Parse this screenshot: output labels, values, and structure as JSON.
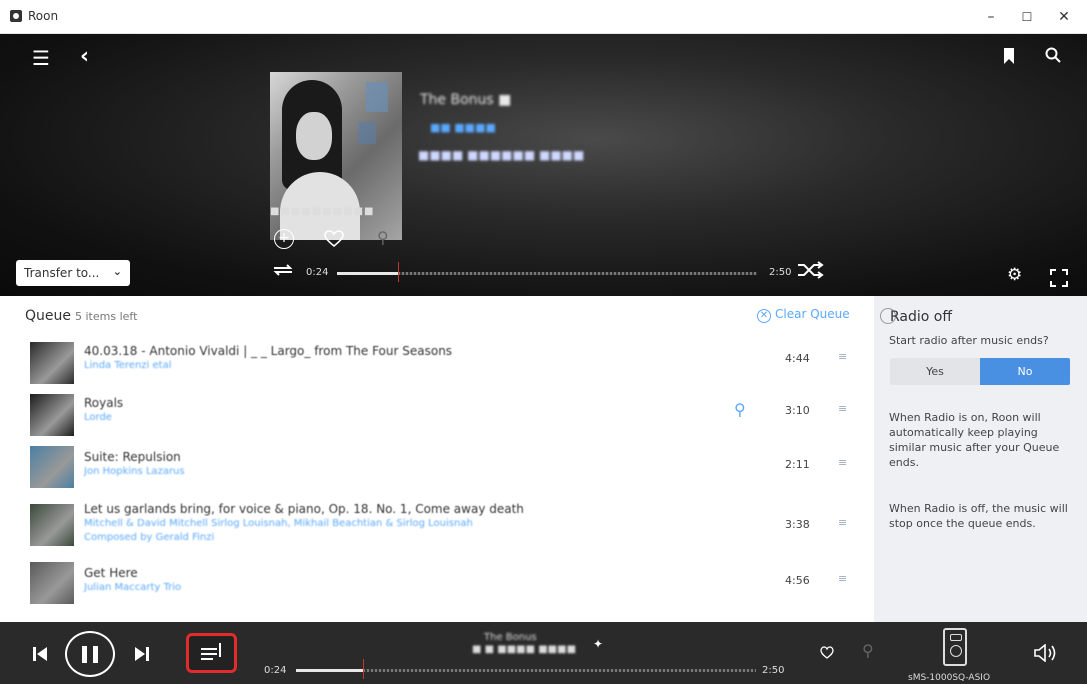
{
  "window": {
    "title": "Roon",
    "minimize": "–",
    "maximize": "☐",
    "close": "✕"
  },
  "hero": {
    "title": "The Bonus ■",
    "artist": "■■ ■■■■",
    "album": "■■■■ ■■■■■■ ■■■■",
    "art_caption": "■■■■■■■■■■",
    "transfer_label": "Transfer to...",
    "time_elapsed": "0:24",
    "time_total": "2:50",
    "progress_fraction": 0.145,
    "icons": [
      "menu-icon",
      "back-icon",
      "bookmark-icon",
      "search-icon",
      "add-icon",
      "heart-icon",
      "pin-icon",
      "repeat-icon",
      "shuffle-icon",
      "settings-icon",
      "fullscreen-icon"
    ]
  },
  "queue": {
    "header": "Queue",
    "subheader": "5 items left",
    "clear_label": "Clear Queue",
    "rows": [
      {
        "title": "40.03.18 - Antonio Vivaldi | _ _ Largo_ from The Four Seasons",
        "artist": "Linda Terenzi etal",
        "duration": "4:44",
        "thumb": "#2a2a2a"
      },
      {
        "title": "Royals",
        "artist": "Lorde",
        "duration": "3:10",
        "thumb": "#1c1c1c"
      },
      {
        "title": "Suite: Repulsion",
        "artist": "Jon Hopkins Lazarus",
        "duration": "2:11",
        "thumb": "#4a7fa3"
      },
      {
        "title": "Let us garlands bring, for voice & piano, Op. 18. No. 1, Come away death",
        "artist": "Mitchell & David Mitchell Sirlog Louisnah, Mikhail Beachtian & Sirlog Louisnah",
        "extra": "Composed by Gerald Finzi",
        "duration": "3:38",
        "thumb": "#3a4a3a"
      },
      {
        "title": "Get Here",
        "artist": "Julian Maccarty Trio",
        "duration": "4:56",
        "thumb": "#5a5a5a"
      }
    ]
  },
  "radio": {
    "title": "Radio off",
    "question": "Start radio after music ends?",
    "yes": "Yes",
    "no": "No",
    "p1": "When Radio is on, Roon will automatically keep playing similar music after your Queue ends.",
    "p2": "When Radio is off, the music will stop once the queue ends."
  },
  "footer": {
    "now_playing_title": "The Bonus",
    "now_playing_artist": "■ ■ ■■■■ ■■■■",
    "time_elapsed": "0:24",
    "time_total": "2:50",
    "progress_fraction": 0.145,
    "zone_name": "sMS-1000SQ-ASIO",
    "icons": [
      "previous-icon",
      "pause-icon",
      "next-icon",
      "queue-icon",
      "sparkle-icon",
      "heart-icon",
      "pin-icon",
      "speaker-icon",
      "volume-icon"
    ]
  }
}
